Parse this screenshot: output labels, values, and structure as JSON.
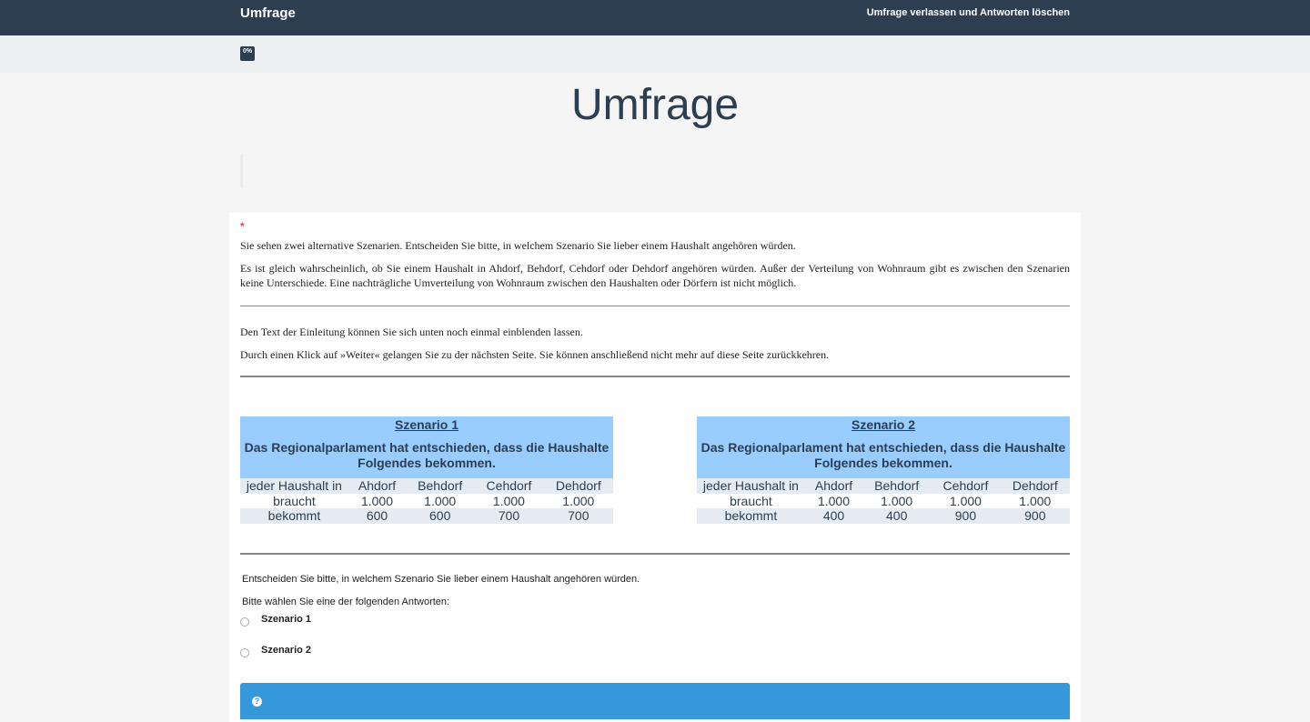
{
  "topbar": {
    "brand": "Umfrage",
    "exit_label": "Umfrage verlassen und Antworten löschen"
  },
  "progress": {
    "label": "0%",
    "value": 0
  },
  "page_title": "Umfrage",
  "question": {
    "required_marker": "*",
    "intro_1": "Sie sehen zwei alternative Szenarien. Entscheiden Sie bitte, in welchem Szenario Sie lieber einem Haushalt angehören würden.",
    "intro_2": "Es ist gleich wahrscheinlich, ob Sie einem Haushalt in Ahdorf, Behdorf, Cehdorf oder Dehdorf angehören würden. Außer der Verteilung von Wohnraum gibt es zwischen den Szenarien keine Unterschiede. Eine nachträgliche Umverteilung von Wohnraum zwischen den Haushalten oder Dörfern ist nicht möglich.",
    "note_1": "Den Text der Einleitung können Sie sich unten noch einmal einblenden lassen.",
    "note_2": "Durch einen Klick auf »Weiter« gelangen Sie zu der nächsten Seite. Sie können anschließend nicht mehr auf diese Seite zurückkehren.",
    "prompt": "Entscheiden Sie bitte, in welchem Szenario Sie lieber einem Haushalt angehören würden.",
    "instruction": "Bitte wählen Sie eine der folgenden Antworten:",
    "options": [
      "Szenario 1",
      "Szenario 2"
    ]
  },
  "scenarios": [
    {
      "title": "Szenario 1",
      "desc": "Das Regionalparlament hat entschieden, dass die Haushalte Folgendes bekommen.",
      "header": [
        "jeder Haushalt in",
        "Ahdorf",
        "Behdorf",
        "Cehdorf",
        "Dehdorf"
      ],
      "row_need": [
        "braucht",
        "1.000",
        "1.000",
        "1.000",
        "1.000"
      ],
      "row_get": [
        "bekommt",
        "600",
        "600",
        "700",
        "700"
      ]
    },
    {
      "title": "Szenario 2",
      "desc": "Das Regionalparlament hat entschieden, dass die Haushalte Folgendes bekommen.",
      "header": [
        "jeder Haushalt in",
        "Ahdorf",
        "Behdorf",
        "Cehdorf",
        "Dehdorf"
      ],
      "row_need": [
        "braucht",
        "1.000",
        "1.000",
        "1.000",
        "1.000"
      ],
      "row_get": [
        "bekommt",
        "400",
        "400",
        "900",
        "900"
      ]
    }
  ],
  "help_icon": "question-circle-icon",
  "colors": {
    "navbar": "#2c3e50",
    "scenario_header": "#99ccff",
    "table_shade": "#e4ebf3",
    "help_bar": "#3498db",
    "required": "#e74c3c"
  }
}
